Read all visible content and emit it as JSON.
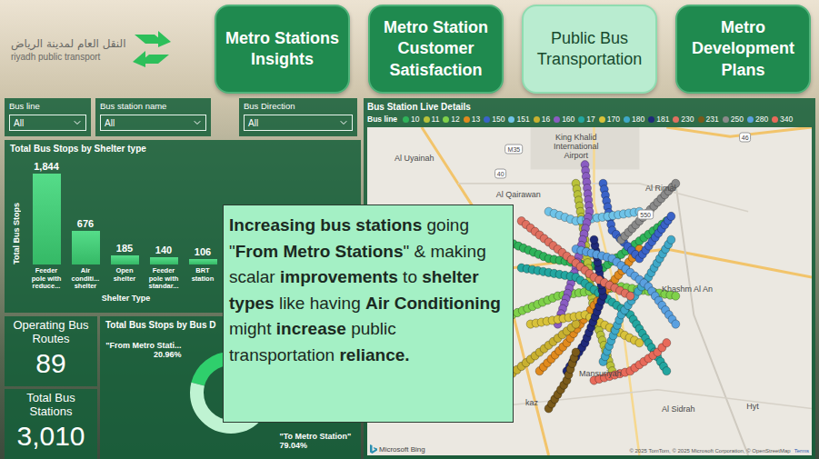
{
  "logo": {
    "arabic": "النقل العام لمدينة الرياض",
    "english": "riyadh public transport"
  },
  "nav": [
    {
      "label": "Metro Stations Insights",
      "selected": false
    },
    {
      "label": "Metro Station Customer Satisfaction",
      "selected": false
    },
    {
      "label": "Public Bus Transportation",
      "selected": true
    },
    {
      "label": "Metro Development Plans",
      "selected": false
    }
  ],
  "filters": [
    {
      "label": "Bus line",
      "value": "All"
    },
    {
      "label": "Bus station name",
      "value": "All"
    },
    {
      "label": "Bus Direction",
      "value": "All"
    }
  ],
  "shelterChart": {
    "title": "Total Bus Stops by Shelter type",
    "yAxis": "Total Bus Stops",
    "xAxis": "Shelter Type",
    "values": [
      1844,
      676,
      185,
      140,
      106
    ],
    "valueLabels": [
      "1,844",
      "676",
      "185",
      "140",
      "106"
    ],
    "categories": [
      "Feeder pole with reduce...",
      "Air conditi... shelter",
      "Open shelter",
      "Feeder pole with standar...",
      "BRT station"
    ]
  },
  "kpis": [
    {
      "label": "Operating Bus Routes",
      "value": "89"
    },
    {
      "label": "Total Bus Stations",
      "value": "3,010"
    }
  ],
  "directionChart": {
    "title": "Total Bus Stops by Bus D",
    "slices": [
      {
        "label": "\"From Metro Stati...",
        "percentText": "20.96%",
        "value": 20.96,
        "color": "#2fcf6c"
      },
      {
        "label": "\"To Metro Station\"",
        "percentText": "79.04%",
        "value": 79.04,
        "color": "#bff3d2"
      }
    ]
  },
  "map": {
    "title": "Bus Station Live Details",
    "legendTitle": "Bus line",
    "legend": [
      {
        "label": "10",
        "color": "#2fb35a",
        "route": [
          [
            150,
            120
          ],
          [
            200,
            140
          ],
          [
            260,
            150
          ],
          [
            330,
            100
          ]
        ]
      },
      {
        "label": "11",
        "color": "#b9c23a",
        "route": [
          [
            230,
            60
          ],
          [
            240,
            120
          ],
          [
            250,
            200
          ],
          [
            270,
            260
          ]
        ]
      },
      {
        "label": "12",
        "color": "#7fd14a",
        "route": [
          [
            160,
            200
          ],
          [
            210,
            180
          ],
          [
            280,
            170
          ],
          [
            340,
            180
          ]
        ]
      },
      {
        "label": "13",
        "color": "#e08a1e",
        "route": [
          [
            190,
            260
          ],
          [
            220,
            230
          ],
          [
            250,
            190
          ],
          [
            300,
            130
          ]
        ]
      },
      {
        "label": "150",
        "color": "#3a63c8",
        "route": [
          [
            260,
            60
          ],
          [
            270,
            110
          ],
          [
            300,
            140
          ],
          [
            335,
            95
          ]
        ]
      },
      {
        "label": "151",
        "color": "#6fc3e8",
        "route": [
          [
            200,
            90
          ],
          [
            230,
            100
          ],
          [
            300,
            90
          ]
        ]
      },
      {
        "label": "16",
        "color": "#c8b030",
        "route": [
          [
            150,
            270
          ],
          [
            190,
            240
          ],
          [
            230,
            210
          ]
        ]
      },
      {
        "label": "160",
        "color": "#8a5cc2",
        "route": [
          [
            240,
            40
          ],
          [
            245,
            90
          ],
          [
            230,
            150
          ],
          [
            210,
            210
          ]
        ]
      },
      {
        "label": "17",
        "color": "#23a6a0",
        "route": [
          [
            170,
            150
          ],
          [
            230,
            160
          ],
          [
            290,
            200
          ],
          [
            330,
            260
          ]
        ]
      },
      {
        "label": "170",
        "color": "#d8c23a",
        "route": [
          [
            180,
            210
          ],
          [
            240,
            200
          ],
          [
            300,
            230
          ]
        ]
      },
      {
        "label": "180",
        "color": "#3fa8c8",
        "route": [
          [
            260,
            250
          ],
          [
            280,
            200
          ],
          [
            310,
            160
          ],
          [
            335,
            120
          ]
        ]
      },
      {
        "label": "181",
        "color": "#1f2a7a",
        "route": [
          [
            220,
            260
          ],
          [
            240,
            230
          ],
          [
            260,
            180
          ],
          [
            250,
            120
          ]
        ]
      },
      {
        "label": "230",
        "color": "#e07060",
        "route": [
          [
            170,
            100
          ],
          [
            210,
            130
          ],
          [
            250,
            160
          ],
          [
            290,
            180
          ]
        ]
      },
      {
        "label": "231",
        "color": "#7a5a1a",
        "route": [
          [
            200,
            300
          ],
          [
            220,
            270
          ],
          [
            230,
            240
          ]
        ]
      },
      {
        "label": "250",
        "color": "#8a8a8a",
        "route": [
          [
            280,
            120
          ],
          [
            300,
            100
          ],
          [
            320,
            80
          ],
          [
            340,
            60
          ]
        ]
      },
      {
        "label": "280",
        "color": "#5aa0e0",
        "route": [
          [
            230,
            130
          ],
          [
            270,
            140
          ],
          [
            310,
            170
          ],
          [
            340,
            210
          ]
        ]
      },
      {
        "label": "340",
        "color": "#e86a5a",
        "route": [
          [
            250,
            270
          ],
          [
            290,
            260
          ],
          [
            320,
            240
          ],
          [
            330,
            230
          ]
        ]
      }
    ],
    "places": [
      {
        "name": "Al Uyainah",
        "x": 10.6,
        "y": 9.4
      },
      {
        "name": "King Khalid International Airport",
        "x": 47,
        "y": 6
      },
      {
        "name": "Al Qairawan",
        "x": 34,
        "y": 20.5
      },
      {
        "name": "Al Rimal",
        "x": 66,
        "y": 18.6
      },
      {
        "name": "Khashm Al An",
        "x": 72,
        "y": 49.4
      },
      {
        "name": "Mansuriyah",
        "x": 52.4,
        "y": 75
      },
      {
        "name": "kaz",
        "x": 37,
        "y": 84
      },
      {
        "name": "Al Sidrah",
        "x": 70,
        "y": 86
      },
      {
        "name": "Hyt",
        "x": 86.7,
        "y": 85
      }
    ],
    "shields": [
      {
        "label": "M35",
        "x": 33,
        "y": 6.6
      },
      {
        "label": "40",
        "x": 30,
        "y": 14
      },
      {
        "label": "46",
        "x": 85,
        "y": 3
      },
      {
        "label": "550",
        "x": 62.6,
        "y": 26.6
      }
    ],
    "brand": "Microsoft Bing",
    "attribution": "© 2025 TomTom, © 2025 Microsoft Corporation, © OpenStreetMap",
    "terms": "Terms"
  },
  "callout": {
    "segments": [
      {
        "text": "Increasing bus stations",
        "bold": true
      },
      {
        "text": " going \"",
        "bold": false
      },
      {
        "text": "From Metro Stations",
        "bold": true
      },
      {
        "text": "\" & making scalar ",
        "bold": false
      },
      {
        "text": "improvements",
        "bold": true
      },
      {
        "text": " to ",
        "bold": false
      },
      {
        "text": "shelter types",
        "bold": true
      },
      {
        "text": " like having ",
        "bold": false
      },
      {
        "text": "Air Conditioning",
        "bold": true
      },
      {
        "text": " might ",
        "bold": false
      },
      {
        "text": "increase",
        "bold": true
      },
      {
        "text": " public transportation ",
        "bold": false
      },
      {
        "text": "reliance.",
        "bold": true
      }
    ]
  }
}
